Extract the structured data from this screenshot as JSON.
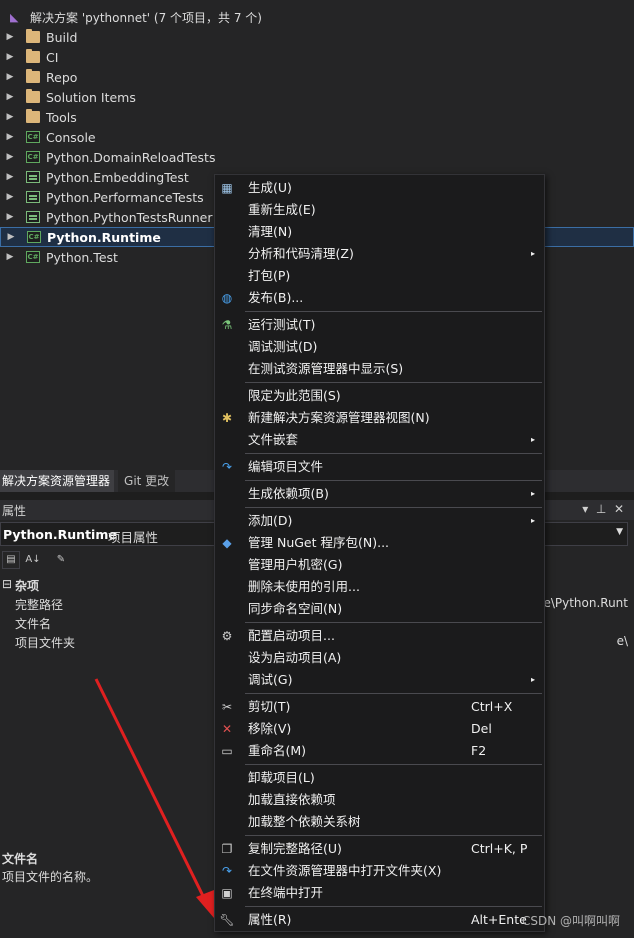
{
  "solution": {
    "title": "解决方案 'pythonnet' (7 个项目，共 7 个)",
    "items": [
      {
        "label": "Build",
        "icon": "folder-icon"
      },
      {
        "label": "CI",
        "icon": "folder-icon"
      },
      {
        "label": "Repo",
        "icon": "folder-icon"
      },
      {
        "label": "Solution Items",
        "icon": "folder-icon"
      },
      {
        "label": "Tools",
        "icon": "folder-icon"
      },
      {
        "label": "Console",
        "icon": "csharp-project-icon",
        "badge": "C#"
      },
      {
        "label": "Python.DomainReloadTests",
        "icon": "csharp-project-icon",
        "badge": "C#"
      },
      {
        "label": "Python.EmbeddingTest",
        "icon": "test-project-icon"
      },
      {
        "label": "Python.PerformanceTests",
        "icon": "test-project-icon"
      },
      {
        "label": "Python.PythonTestsRunner",
        "icon": "test-project-icon"
      },
      {
        "label": "Python.Runtime",
        "icon": "csharp-project-icon",
        "badge": "C#"
      },
      {
        "label": "Python.Test",
        "icon": "csharp-project-icon",
        "badge": "C#"
      }
    ]
  },
  "tabs": [
    {
      "label": "解决方案资源管理器"
    },
    {
      "label": "Git 更改"
    }
  ],
  "properties": {
    "title": "属性",
    "object_name": "Python.Runtime",
    "object_type": "项目属性",
    "category": "杂项",
    "rows": [
      {
        "name": "完整路径",
        "value": "e\\Python.Runt"
      },
      {
        "name": "文件名",
        "value": ""
      },
      {
        "name": "项目文件夹",
        "value": "e\\"
      }
    ],
    "desc_title": "文件名",
    "desc_text": "项目文件的名称。"
  },
  "menu": {
    "items": [
      {
        "label": "生成(U)",
        "icon": "build-icon"
      },
      {
        "label": "重新生成(E)"
      },
      {
        "label": "清理(N)"
      },
      {
        "label": "分析和代码清理(Z)",
        "submenu": "▸"
      },
      {
        "label": "打包(P)"
      },
      {
        "label": "发布(B)...",
        "icon": "globe-icon"
      },
      {
        "label": "运行测试(T)",
        "icon": "flask-icon"
      },
      {
        "label": "调试测试(D)"
      },
      {
        "label": "在测试资源管理器中显示(S)"
      },
      {
        "label": "限定为此范围(S)"
      },
      {
        "label": "新建解决方案资源管理器视图(N)",
        "icon": "new-view-icon"
      },
      {
        "label": "文件嵌套",
        "submenu": "▸"
      },
      {
        "label": "编辑项目文件",
        "icon": "edit-redo-icon"
      },
      {
        "label": "生成依赖项(B)",
        "submenu": "▸"
      },
      {
        "label": "添加(D)",
        "submenu": "▸"
      },
      {
        "label": "管理 NuGet 程序包(N)...",
        "icon": "nuget-icon"
      },
      {
        "label": "管理用户机密(G)"
      },
      {
        "label": "删除未使用的引用..."
      },
      {
        "label": "同步命名空间(N)"
      },
      {
        "label": "配置启动项目...",
        "icon": "gear-icon"
      },
      {
        "label": "设为启动项目(A)"
      },
      {
        "label": "调试(G)",
        "submenu": "▸"
      },
      {
        "label": "剪切(T)",
        "shortcut": "Ctrl+X",
        "icon": "scissors-icon"
      },
      {
        "label": "移除(V)",
        "shortcut": "Del",
        "icon": "remove-x-icon"
      },
      {
        "label": "重命名(M)",
        "shortcut": "F2",
        "icon": "rename-icon"
      },
      {
        "label": "卸载项目(L)"
      },
      {
        "label": "加载直接依赖项"
      },
      {
        "label": "加载整个依赖关系树"
      },
      {
        "label": "复制完整路径(U)",
        "shortcut": "Ctrl+K, P",
        "icon": "copy-icon"
      },
      {
        "label": "在文件资源管理器中打开文件夹(X)",
        "icon": "open-folder-arrow-icon"
      },
      {
        "label": "在终端中打开",
        "icon": "terminal-icon"
      },
      {
        "label": "属性(R)",
        "shortcut": "Alt+Ente",
        "icon": "wrench-icon"
      }
    ]
  },
  "watermark": "CSDN @叫啊叫啊",
  "colors": {
    "accent": "#3b6ea5",
    "arrow": "#e02020",
    "menu_bg": "#1b1b1c"
  }
}
